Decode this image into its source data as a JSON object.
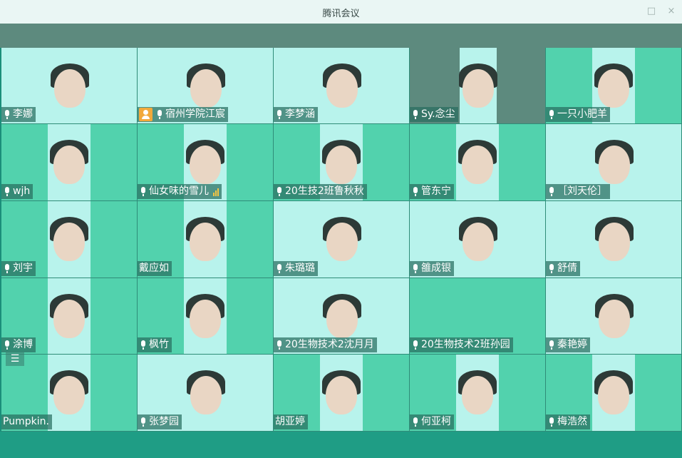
{
  "window": {
    "title": "腾讯会议",
    "minimize_glyph": "□",
    "close_glyph": "×"
  },
  "participants": [
    {
      "name": "李娜",
      "mic": true
    },
    {
      "name": "宿州学院江宸",
      "mic": true,
      "host": true
    },
    {
      "name": "李梦涵",
      "mic": true
    },
    {
      "name": "Sy.念尘",
      "mic": true
    },
    {
      "name": "一只小肥羊",
      "mic": true
    },
    {
      "name": "wjh",
      "mic": true
    },
    {
      "name": "仙女味的雪儿",
      "mic": true,
      "signal": true
    },
    {
      "name": "20生技2班鲁秋秋",
      "mic": true
    },
    {
      "name": "管东宁",
      "mic": true
    },
    {
      "name": "［刘天伦］",
      "mic": true
    },
    {
      "name": "刘宇",
      "mic": true
    },
    {
      "name": "戴应如",
      "mic": false
    },
    {
      "name": "朱璐璐",
      "mic": true
    },
    {
      "name": "雒成银",
      "mic": true
    },
    {
      "name": "舒倩",
      "mic": true
    },
    {
      "name": "涂博",
      "mic": true
    },
    {
      "name": "枫竹",
      "mic": true
    },
    {
      "name": "20生物技术2沈月月",
      "mic": true
    },
    {
      "name": "20生物技术2班孙园",
      "mic": true
    },
    {
      "name": "秦艳婷",
      "mic": true
    },
    {
      "name": "Pumpkin.",
      "mic": false
    },
    {
      "name": "张梦园",
      "mic": true
    },
    {
      "name": "胡亚婷",
      "mic": false
    },
    {
      "name": "何亚柯",
      "mic": true
    },
    {
      "name": "梅浩然",
      "mic": true
    }
  ],
  "icons": {
    "mic": "microphone-icon",
    "host": "host-badge-icon",
    "signal": "signal-strength-icon",
    "list": "participant-list-icon"
  },
  "colors": {
    "tile": "#52d2ad",
    "title_bar": "#eaf6f4",
    "accent": "#1f9d85",
    "host_badge": "#f2a93b"
  }
}
